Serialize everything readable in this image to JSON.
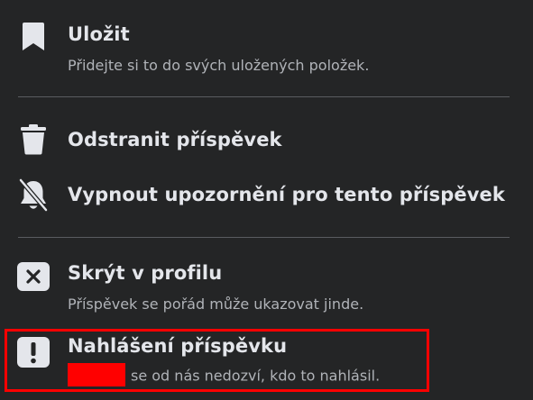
{
  "menu": {
    "items": [
      {
        "title": "Uložit",
        "subtitle": "Přidejte si to do svých uložených položek.",
        "icon": "bookmark-icon"
      },
      {
        "title": "Odstranit příspěvek",
        "icon": "trash-icon"
      },
      {
        "title": "Vypnout upozornění pro tento příspěvek",
        "icon": "bell-off-icon"
      },
      {
        "title": "Skrýt v profilu",
        "subtitle": "Příspěvek se pořád může ukazovat jinde.",
        "icon": "close-box-icon"
      },
      {
        "title": "Nahlášení příspěvku",
        "subtitle": "se od nás nedozví, kdo to nahlásil.",
        "icon": "alert-box-icon"
      }
    ]
  },
  "colors": {
    "background": "#242526",
    "primary_text": "#e4e6eb",
    "secondary_text": "#b0b3b8",
    "annotation_red": "#ff0000"
  }
}
